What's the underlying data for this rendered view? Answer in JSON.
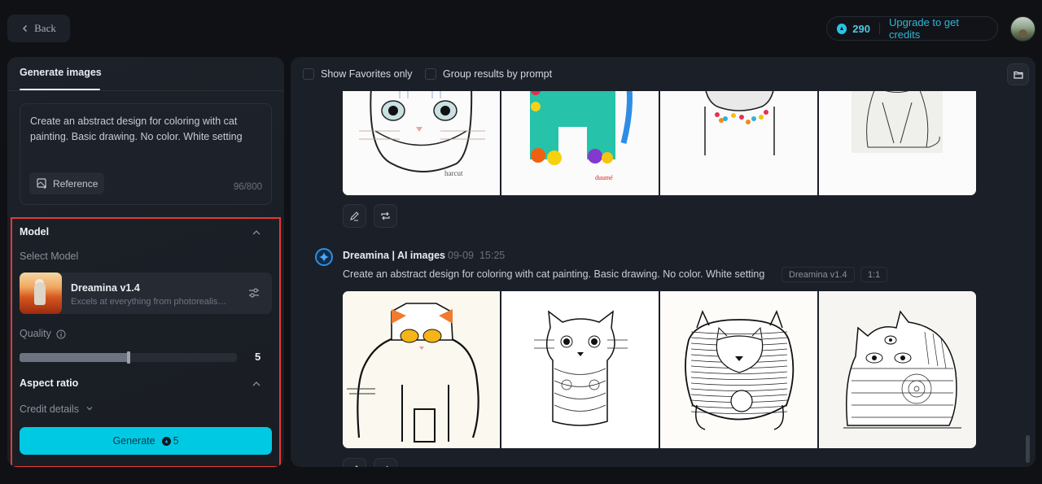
{
  "topbar": {
    "back_label": "Back",
    "credits": "290",
    "upgrade_label": "Upgrade to get credits"
  },
  "left_panel": {
    "tab_label": "Generate images",
    "prompt": "Create an abstract design for coloring with cat painting. Basic drawing. No color. White setting",
    "reference_label": "Reference",
    "char_count": "96/800",
    "model_section_title": "Model",
    "select_model_label": "Select Model",
    "model": {
      "name": "Dreamina v1.4",
      "description": "Excels at everything from photorealism to painterly style"
    },
    "quality_label": "Quality",
    "quality_value": "5",
    "quality_fraction": 0.5,
    "aspect_ratio_label": "Aspect ratio",
    "credit_details_label": "Credit details",
    "generate_label": "Generate",
    "generate_cost": "5"
  },
  "main": {
    "filters": {
      "favorites_label": "Show Favorites only",
      "favorites_checked": false,
      "group_label": "Group results by prompt",
      "group_checked": false
    },
    "generation": {
      "author": "Dreamina | AI images",
      "date": "09-09",
      "time": "15:25",
      "prompt": "Create an abstract design for coloring with cat painting. Basic drawing. No color. White setting",
      "model_tag": "Dreamina v1.4",
      "ratio_tag": "1:1"
    },
    "previous_images": [
      "cat-face-line-drawing",
      "teal-colorful-cat",
      "cat-with-beaded-collar",
      "sitting-cat-outline"
    ],
    "current_images": [
      "round-cat-orange-ears",
      "zentangle-kitten",
      "striped-round-cat",
      "patterned-two-cats"
    ]
  }
}
